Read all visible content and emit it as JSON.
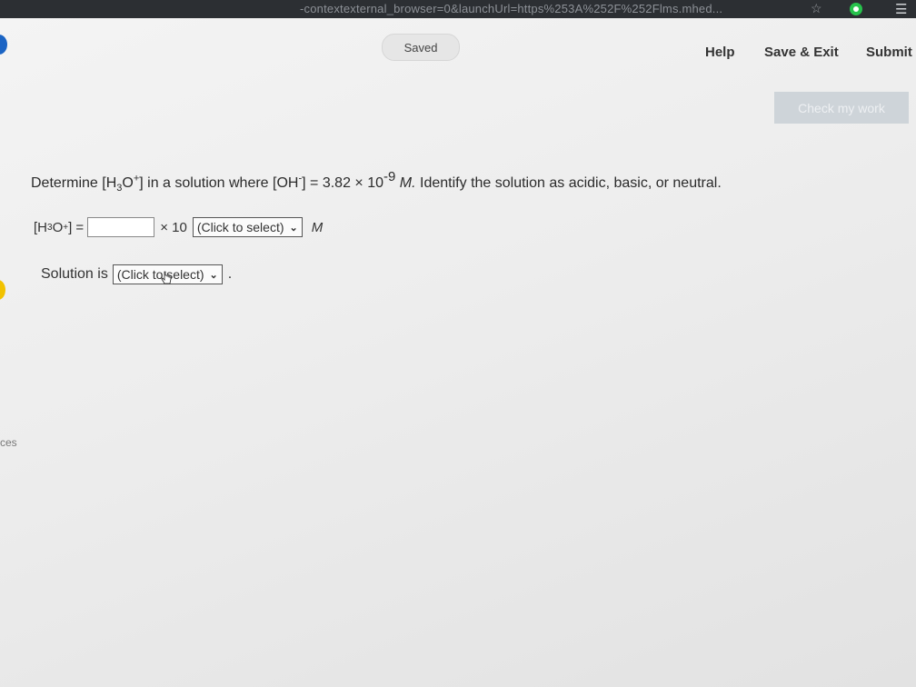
{
  "browser": {
    "url_fragment": "-contextexternal_browser=0&launchUrl=https%253A%252F%252Flms.mhed...",
    "icons": [
      "star-icon",
      "extension-icon",
      "reading-list-icon"
    ]
  },
  "header": {
    "saved_label": "Saved",
    "help_label": "Help",
    "save_exit_label": "Save & Exit",
    "submit_label": "Submit",
    "check_work_label": "Check my work"
  },
  "left_edge": {
    "cut_text": "ces"
  },
  "question": {
    "prefix": "Determine [H",
    "sub_3": "3",
    "o_text": "O",
    "plus": "+",
    "mid": "] in a solution where [OH",
    "minus": "-",
    "equals_text": "] = 3.82 × 10",
    "exponent": "-9",
    "unit": "M.",
    "suffix": "Identify the solution as acidic, basic, or neutral."
  },
  "answer": {
    "label_prefix": "[H",
    "label_sub": "3",
    "label_o": "O",
    "label_plus": "+",
    "label_suffix": "] =",
    "input_value": "",
    "times_ten": "× 10",
    "exponent_select": "(Click to select)",
    "unit": "M"
  },
  "solution": {
    "label": "Solution is",
    "select_value": "(Click to select)",
    "period": "."
  },
  "colors": {
    "check_work_bg": "#c9d0d6",
    "browser_bar": "#2c2f33",
    "accent_blue": "#1b64c4"
  }
}
